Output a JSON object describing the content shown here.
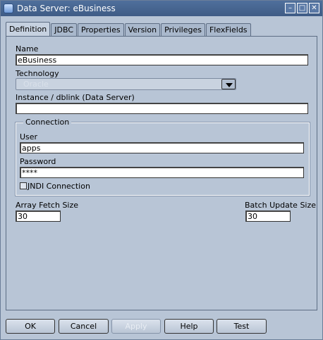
{
  "window": {
    "title": "Data Server: eBusiness"
  },
  "tabs": [
    {
      "label": "Definition",
      "active": true
    },
    {
      "label": "JDBC",
      "active": false
    },
    {
      "label": "Properties",
      "active": false
    },
    {
      "label": "Version",
      "active": false
    },
    {
      "label": "Privileges",
      "active": false
    },
    {
      "label": "FlexFields",
      "active": false
    }
  ],
  "form": {
    "name_label": "Name",
    "name_value": "eBusiness",
    "technology_label": "Technology",
    "technology_value": "Oracle",
    "instance_label": "Instance / dblink (Data Server)",
    "instance_value": "",
    "connection_group": "Connection",
    "user_label": "User",
    "user_value": "apps",
    "password_label": "Password",
    "password_value": "****",
    "jndi_label": "JNDI Connection",
    "jndi_checked": false,
    "array_fetch_label": "Array Fetch Size",
    "array_fetch_value": "30",
    "batch_update_label": "Batch Update Size",
    "batch_update_value": "30"
  },
  "buttons": {
    "ok": "OK",
    "cancel": "Cancel",
    "apply": "Apply",
    "help": "Help",
    "test": "Test"
  },
  "colors": {
    "background": "#b8c5d6",
    "titlebar": "#4f6f9c"
  }
}
